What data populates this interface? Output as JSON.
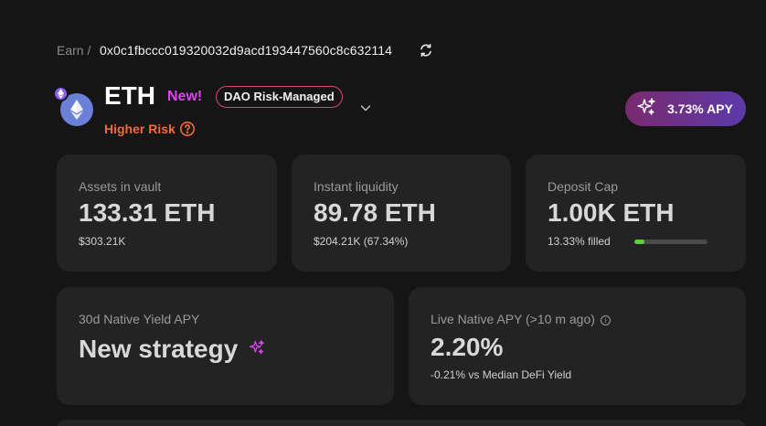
{
  "breadcrumb": {
    "root": "Earn /",
    "address": "0x0c1fbccc019320032d9acd193447560c8c632114"
  },
  "vault": {
    "token": "ETH",
    "new_label": "New!",
    "badge": "DAO Risk-Managed",
    "risk": "Higher Risk",
    "apy": "3.73% APY"
  },
  "stats": {
    "assets": {
      "label": "Assets in vault",
      "value": "133.31 ETH",
      "sub": "$303.21K"
    },
    "liquidity": {
      "label": "Instant liquidity",
      "value": "89.78 ETH",
      "sub": "$204.21K (67.34%)"
    },
    "cap": {
      "label": "Deposit Cap",
      "value": "1.00K ETH",
      "sub": "13.33% filled",
      "fill_fraction": 0.1333
    }
  },
  "yield": {
    "native30d": {
      "label": "30d Native Yield APY",
      "value": "New strategy"
    },
    "live": {
      "label": "Live Native APY (>10 m ago)",
      "value": "2.20%",
      "sub": "-0.21% vs Median DeFi Yield"
    }
  },
  "colors": {
    "accent_pink": "#d946ef",
    "risk_orange": "#f26b3a",
    "progress_green": "#5ad33a",
    "eth_blue": "#6a7fd6"
  },
  "icons": [
    "refresh-icon",
    "eth-icon",
    "chain-icon",
    "chevron-down-icon",
    "help-circle-icon",
    "sparkle-icon",
    "info-icon"
  ]
}
